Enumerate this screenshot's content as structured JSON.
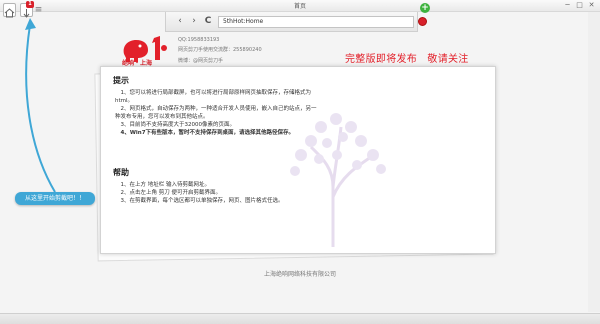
{
  "window": {
    "title": "首页"
  },
  "toolbar": {
    "badge_count": "1",
    "min_glyph": "─",
    "max_glyph": "□",
    "close_glyph": "✕",
    "menu_glyph": "≡"
  },
  "nav": {
    "back_glyph": "‹",
    "forward_glyph": "›",
    "reload_glyph": "C",
    "address_value": "5thHot:Home",
    "add_glyph": "+"
  },
  "brand": {
    "logo_text": "绝响・上海",
    "qq": "QQ:1958833193",
    "group": "网页剪刀手使用交流群：255890240",
    "weibo": "微博：@网页剪刀手"
  },
  "promo": "完整版即将发布　敬请关注",
  "tips": {
    "title": "提示",
    "lines": [
      "　1、您可以将进行局部截屏，也可以将进行局部原样网页抽取保存，存储格式为",
      "html。",
      "　2、网页格式，自动保存为两种，一种适合开发人员使用，嵌入自己的站点，另一",
      "种发布专用，您可以发布到其他站点。",
      "　3、目前尚不支持高度大于32000像素的页面。",
      "　4、Win7下有些版本，暂时不支持保存到桌面，请选择其他路径保存。"
    ]
  },
  "help": {
    "title": "帮助",
    "lines": [
      "　1、在上方 地址栏 输入待剪截网址。",
      "　2、点击左上角 剪刀 便可开启剪截界面。",
      "　3、在剪截界面，每个选区都可以单独保存，网页、图片格式任选。"
    ]
  },
  "callout": "从这里开始剪截吧！！",
  "footer": "上海绝响网络科技有限公司",
  "colors": {
    "accent_red": "#e2202a",
    "callout_blue": "#3fa7d6",
    "add_green": "#3db23d"
  }
}
